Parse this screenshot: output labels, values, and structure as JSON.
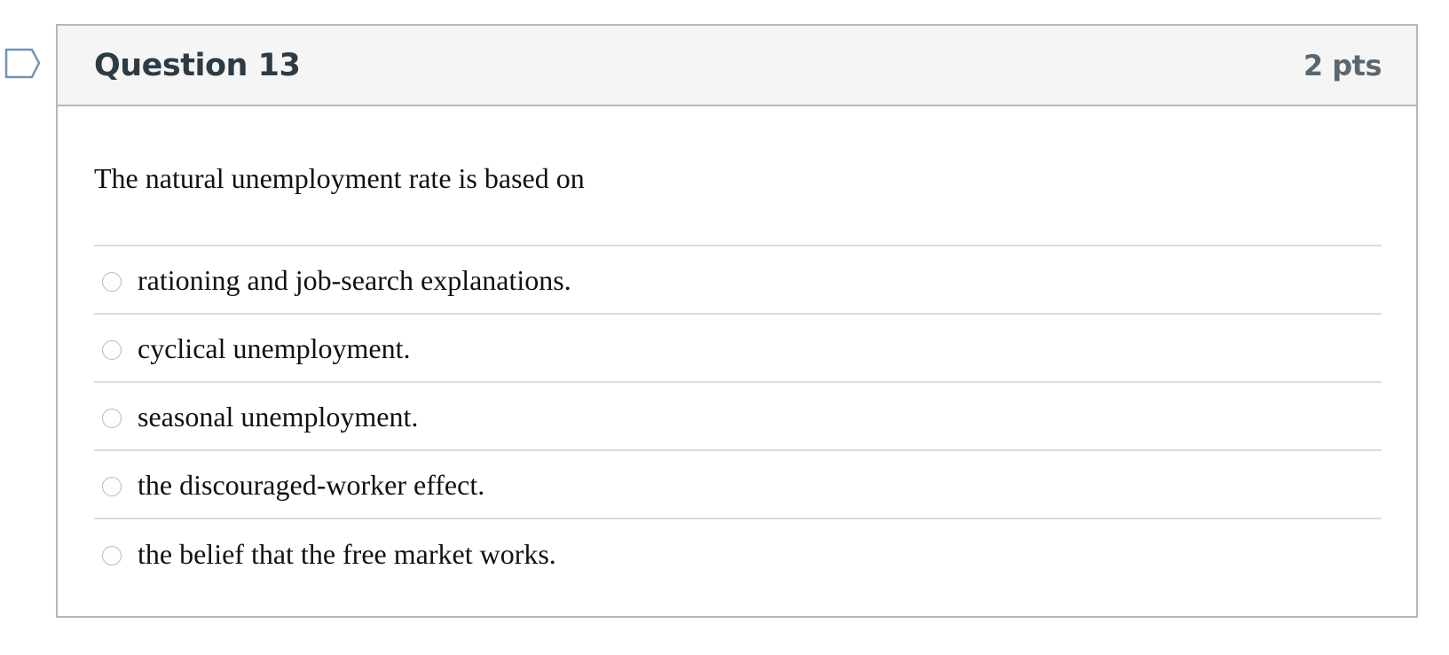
{
  "question": {
    "title": "Question 13",
    "points": "2 pts",
    "text": "The natural unemployment rate is based on",
    "flag_icon": "flag-outline-icon",
    "answers": [
      {
        "label": "rationing and job-search explanations.",
        "selected": false
      },
      {
        "label": "cyclical unemployment.",
        "selected": false
      },
      {
        "label": "seasonal unemployment.",
        "selected": false
      },
      {
        "label": "the discouraged-worker effect.",
        "selected": false
      },
      {
        "label": "the belief that the free market works.",
        "selected": false
      }
    ]
  },
  "colors": {
    "header_bg": "#f5f5f5",
    "border": "#b7b7b7",
    "title_text": "#2d3b45",
    "points_text": "#5b6770",
    "flag_stroke": "#7593b2"
  }
}
